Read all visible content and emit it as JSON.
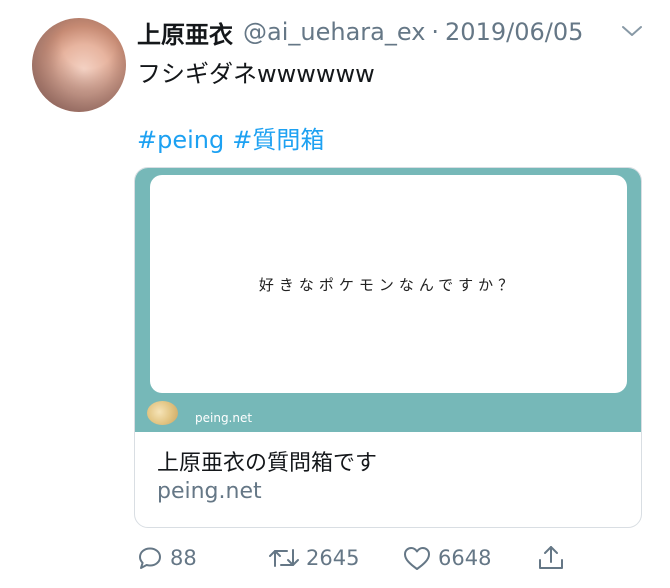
{
  "tweet": {
    "author_name": "上原亜衣",
    "handle": "@ai_uehara_ex",
    "separator": "·",
    "date": "2019/06/05",
    "text": "フシギダネwwwwww",
    "hashtags": [
      "#peing",
      "#質問箱"
    ]
  },
  "card": {
    "question": "好きなポケモンなんですか？",
    "media_site": "peing.net",
    "title": "上原亜衣の質問箱です",
    "domain": "peing.net"
  },
  "actions": {
    "reply_count": "88",
    "retweet_count": "2645",
    "like_count": "6648"
  },
  "colors": {
    "link": "#1da1f2",
    "muted": "#657786",
    "card_bg": "#76b8b8"
  },
  "icons": [
    "chevron-down-icon",
    "reply-icon",
    "retweet-icon",
    "like-icon",
    "share-icon"
  ]
}
